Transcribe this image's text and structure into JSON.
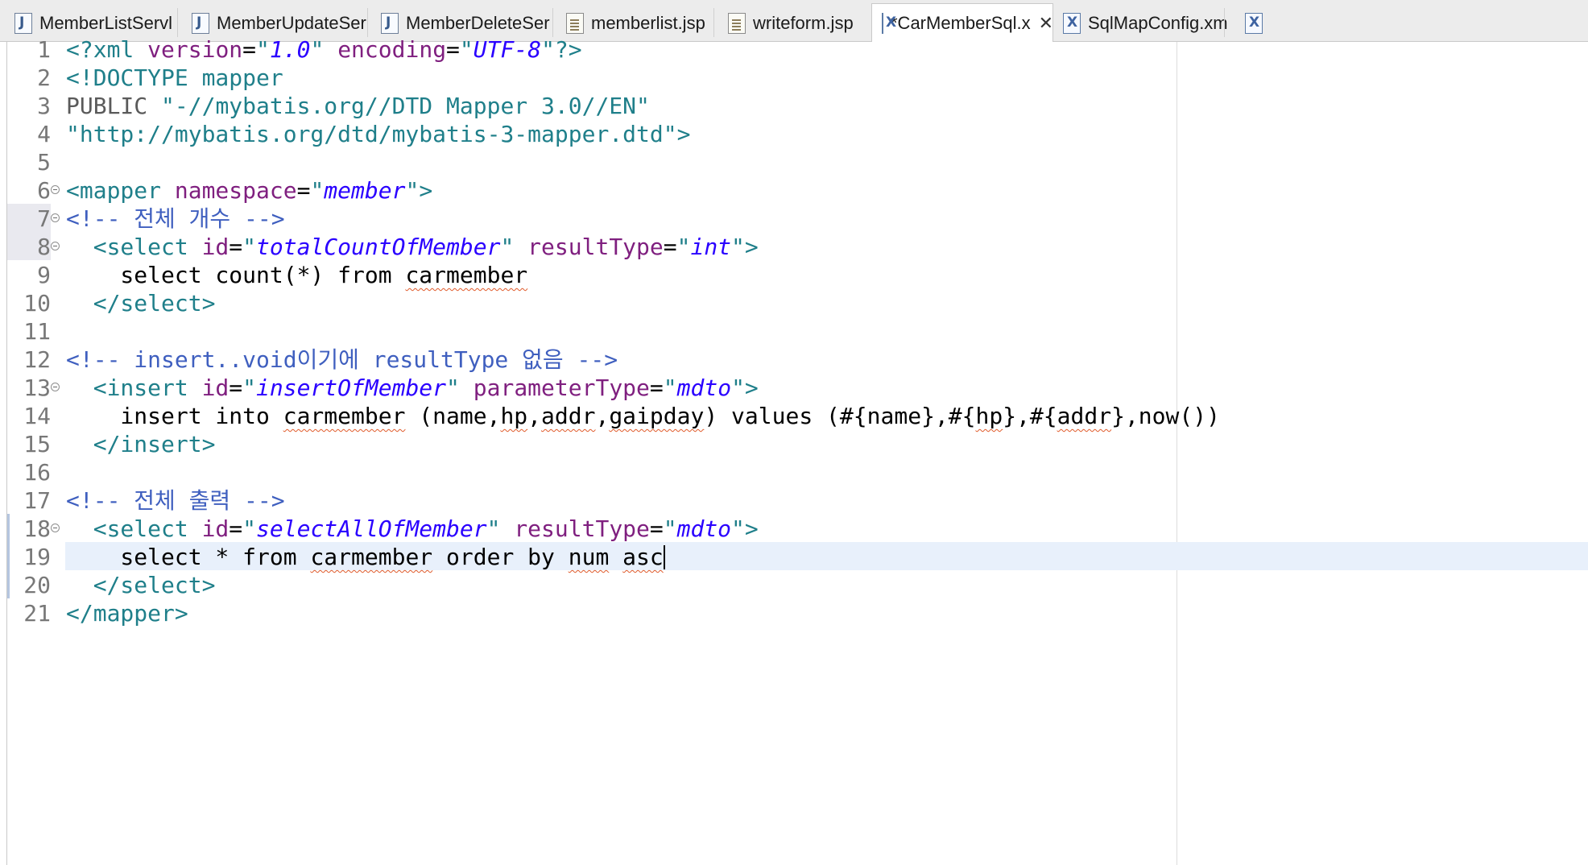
{
  "tabs": [
    {
      "label": "MemberListServl",
      "icon": "java-file-icon"
    },
    {
      "label": "MemberUpdateSer",
      "icon": "java-file-icon"
    },
    {
      "label": "MemberDeleteSer",
      "icon": "java-file-icon"
    },
    {
      "label": "memberlist.jsp",
      "icon": "jsp-file-icon"
    },
    {
      "label": "writeform.jsp",
      "icon": "jsp-file-icon"
    },
    {
      "label": "*CarMemberSql.x",
      "icon": "xml-file-icon",
      "active": true
    },
    {
      "label": "SqlMapConfig.xm",
      "icon": "xml-file-icon"
    }
  ],
  "editor": {
    "lines": [
      {
        "n": "1",
        "t": [
          [
            "<?",
            "tag"
          ],
          [
            "xml ",
            "tag"
          ],
          [
            "version",
            "attr"
          ],
          [
            "=",
            "plain"
          ],
          [
            "\"",
            "dstr"
          ],
          [
            "1.0",
            "str"
          ],
          [
            "\"",
            "dstr"
          ],
          [
            " ",
            "plain"
          ],
          [
            "encoding",
            "attr"
          ],
          [
            "=",
            "plain"
          ],
          [
            "\"",
            "dstr"
          ],
          [
            "UTF-8",
            "str"
          ],
          [
            "\"",
            "dstr"
          ],
          [
            "?>",
            "tag"
          ]
        ]
      },
      {
        "n": "2",
        "t": [
          [
            "<!DOCTYPE mapper",
            "tag"
          ]
        ]
      },
      {
        "n": "3",
        "t": [
          [
            "PUBLIC ",
            "doc"
          ],
          [
            "\"-//mybatis.org//DTD Mapper 3.0//EN\"",
            "dstr"
          ]
        ]
      },
      {
        "n": "4",
        "t": [
          [
            "\"http://mybatis.org/dtd/mybatis-3-mapper.dtd\"",
            "dstr"
          ],
          [
            ">",
            "tag"
          ]
        ]
      },
      {
        "n": "5",
        "t": []
      },
      {
        "n": "6",
        "fold": true,
        "t": [
          [
            "<mapper ",
            "tag"
          ],
          [
            "namespace",
            "attr"
          ],
          [
            "=",
            "plain"
          ],
          [
            "\"",
            "dstr"
          ],
          [
            "member",
            "str"
          ],
          [
            "\"",
            "dstr"
          ],
          [
            ">",
            "tag"
          ]
        ]
      },
      {
        "n": "7",
        "fold": true,
        "t": [
          [
            "<!-- 전체 개수 -->",
            "com"
          ]
        ]
      },
      {
        "n": "8",
        "fold": true,
        "t": [
          [
            "  ",
            "plain"
          ],
          [
            "<select ",
            "tag"
          ],
          [
            "id",
            "attr"
          ],
          [
            "=",
            "plain"
          ],
          [
            "\"",
            "dstr"
          ],
          [
            "totalCountOfMember",
            "str"
          ],
          [
            "\"",
            "dstr"
          ],
          [
            " ",
            "plain"
          ],
          [
            "resultType",
            "attr"
          ],
          [
            "=",
            "plain"
          ],
          [
            "\"",
            "dstr"
          ],
          [
            "int",
            "str"
          ],
          [
            "\"",
            "dstr"
          ],
          [
            ">",
            "tag"
          ]
        ]
      },
      {
        "n": "9",
        "t": [
          [
            "    select count(*) from ",
            "plain"
          ],
          [
            "carmember",
            "sq"
          ]
        ]
      },
      {
        "n": "10",
        "t": [
          [
            "  ",
            "plain"
          ],
          [
            "</select>",
            "tag"
          ]
        ]
      },
      {
        "n": "11",
        "t": []
      },
      {
        "n": "12",
        "t": [
          [
            "<!-- insert..void이기에 resultType 없음 -->",
            "com"
          ]
        ]
      },
      {
        "n": "13",
        "fold": true,
        "t": [
          [
            "  ",
            "plain"
          ],
          [
            "<insert ",
            "tag"
          ],
          [
            "id",
            "attr"
          ],
          [
            "=",
            "plain"
          ],
          [
            "\"",
            "dstr"
          ],
          [
            "insertOfMember",
            "str"
          ],
          [
            "\"",
            "dstr"
          ],
          [
            " ",
            "plain"
          ],
          [
            "parameterType",
            "attr"
          ],
          [
            "=",
            "plain"
          ],
          [
            "\"",
            "dstr"
          ],
          [
            "mdto",
            "str"
          ],
          [
            "\"",
            "dstr"
          ],
          [
            ">",
            "tag"
          ]
        ]
      },
      {
        "n": "14",
        "t": [
          [
            "    insert into ",
            "plain"
          ],
          [
            "carmember",
            "sq"
          ],
          [
            " (name,",
            "plain"
          ],
          [
            "hp",
            "sq"
          ],
          [
            ",",
            "plain"
          ],
          [
            "addr",
            "sq"
          ],
          [
            ",",
            "plain"
          ],
          [
            "gaipday",
            "sq"
          ],
          [
            ") values (#{name},#{",
            "plain"
          ],
          [
            "hp",
            "sq"
          ],
          [
            "},#{",
            "plain"
          ],
          [
            "addr",
            "sq"
          ],
          [
            "},now())",
            "plain"
          ]
        ]
      },
      {
        "n": "15",
        "t": [
          [
            "  ",
            "plain"
          ],
          [
            "</insert>",
            "tag"
          ]
        ]
      },
      {
        "n": "16",
        "t": []
      },
      {
        "n": "17",
        "t": [
          [
            "<!-- 전체 출력 -->",
            "com"
          ]
        ]
      },
      {
        "n": "18",
        "fold": true,
        "t": [
          [
            "  ",
            "plain"
          ],
          [
            "<select ",
            "tag"
          ],
          [
            "id",
            "attr"
          ],
          [
            "=",
            "plain"
          ],
          [
            "\"",
            "dstr"
          ],
          [
            "selectAllOfMember",
            "str"
          ],
          [
            "\"",
            "dstr"
          ],
          [
            " ",
            "plain"
          ],
          [
            "resultType",
            "attr"
          ],
          [
            "=",
            "plain"
          ],
          [
            "\"",
            "dstr"
          ],
          [
            "mdto",
            "str"
          ],
          [
            "\"",
            "dstr"
          ],
          [
            ">",
            "tag"
          ]
        ]
      },
      {
        "n": "19",
        "current": true,
        "t": [
          [
            "    select * from ",
            "plain"
          ],
          [
            "carmember",
            "sq"
          ],
          [
            " order by ",
            "plain"
          ],
          [
            "num",
            "sq"
          ],
          [
            " ",
            "plain"
          ],
          [
            "asc",
            "sq"
          ]
        ]
      },
      {
        "n": "20",
        "t": [
          [
            "  ",
            "plain"
          ],
          [
            "</select>",
            "tag"
          ]
        ]
      },
      {
        "n": "21",
        "t": [
          [
            "</mapper>",
            "tag"
          ]
        ]
      }
    ]
  }
}
